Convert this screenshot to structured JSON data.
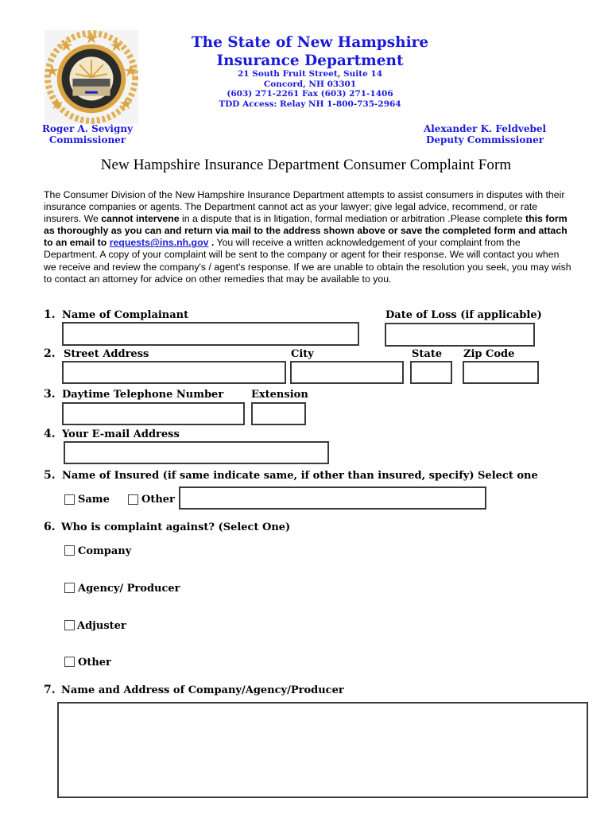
{
  "header": {
    "seal_icon": "nh-insurance-department-seal",
    "title_line1": "The State of New  Hampshire",
    "title_line2": "Insurance Department",
    "address_line1": "21 South Fruit Street, Suite 14",
    "address_line2": "Concord, NH 03301",
    "phone_line": "(603) 271-2261 Fax (603) 271-1406",
    "tdd_line": "TDD Access: Relay NH 1-800-735-2964",
    "brand_color": "#1a1adb",
    "seal_gold": "#d9a441"
  },
  "officials": {
    "left_name": "Roger A. Sevigny",
    "left_title": "Commissioner",
    "right_name": "Alexander K. Feldvebel",
    "right_title": "Deputy Commissioner"
  },
  "form_title": "New Hampshire Insurance Department Consumer Complaint Form",
  "intro": {
    "p1": "The Consumer Division of the New Hampshire Insurance Department attempts to assist consumers in disputes with their insurance companies or agents. The Department cannot act as your lawyer; give legal advice, recommend, or rate insurers. We ",
    "b1": "cannot intervene",
    "p2": " in a dispute that is in litigation, formal mediation or arbitration .Please complete ",
    "b2": "this form as thoroughly as you can and return via mail to the address shown above or save the completed form and attach to an email to ",
    "email": "requests@ins.nh.gov",
    "b3": " .",
    "p3": " You will receive a written acknowledgement of your complaint from the Department. A copy of your complaint will be sent to the company or agent for their response. We will contact you when we receive and review the company's / agent's response. If we are unable to obtain the resolution you seek, you may wish to contact an attorney for advice on other remedies that may be available to you."
  },
  "questions": {
    "q1": {
      "num": "1.",
      "label": "Name of Complainant",
      "date_label": "Date of Loss (if applicable)",
      "value": "",
      "date_value": ""
    },
    "q2": {
      "num": "2.",
      "street_label": "Street Address",
      "city_label": "City",
      "state_label": "State",
      "zip_label": "Zip Code",
      "street_value": "",
      "city_value": "",
      "state_value": "",
      "zip_value": ""
    },
    "q3": {
      "num": "3.",
      "phone_label": "Daytime Telephone Number",
      "ext_label": "Extension",
      "phone_value": "",
      "ext_value": ""
    },
    "q4": {
      "num": "4.",
      "label": "Your E-mail Address",
      "value": ""
    },
    "q5": {
      "num": "5.",
      "label": "Name of Insured (if same indicate same, if other than insured, specify)  Select one",
      "opt_same": "Same",
      "opt_other": "Other",
      "same_checked": false,
      "other_checked": false,
      "other_value": ""
    },
    "q6": {
      "num": "6.",
      "label": "Who is complaint against? (Select One)",
      "options": [
        {
          "label": "Company",
          "checked": false
        },
        {
          "label": "Agency/ Producer",
          "checked": false
        },
        {
          "label": "Adjuster",
          "checked": false
        },
        {
          "label": "Other",
          "checked": false
        }
      ]
    },
    "q7": {
      "num": "7.",
      "label": "Name and Address of Company/Agency/Producer",
      "value": ""
    }
  }
}
